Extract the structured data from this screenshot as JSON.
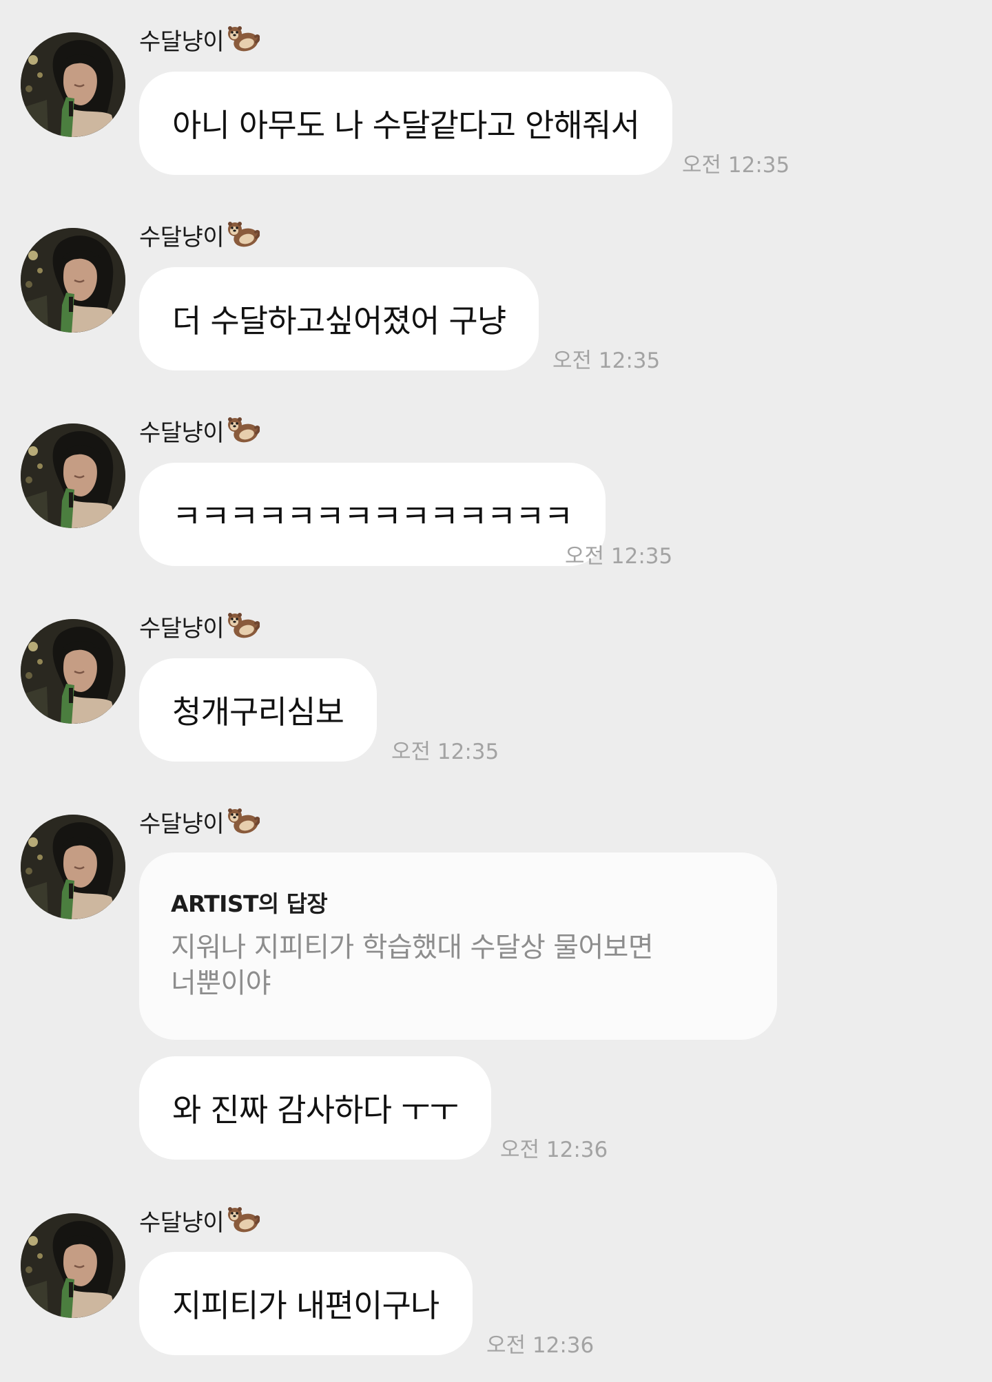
{
  "chat": {
    "sender_name": "수달냥이",
    "messages": [
      {
        "text": "아니 아무도 나 수달같다고 안해줘서",
        "time": "오전 12:35"
      },
      {
        "text": "더 수달하고싶어졌어 구냥",
        "time": "오전 12:35"
      },
      {
        "text": "ㅋㅋㅋㅋㅋㅋㅋㅋㅋㅋㅋㅋㅋㅋ",
        "time": "오전 12:35"
      },
      {
        "text": "청개구리심보",
        "time": "오전 12:35"
      },
      {
        "reply": {
          "title": "ARTIST의 답장",
          "quote": "지워나 지피티가 학습했대 수달상 물어보면 너뿐이야"
        },
        "text": "와 진짜 감사하다 ㅜㅜ",
        "time": "오전 12:36"
      },
      {
        "text": "지피티가 내편이구나",
        "time": "오전 12:36"
      }
    ]
  }
}
